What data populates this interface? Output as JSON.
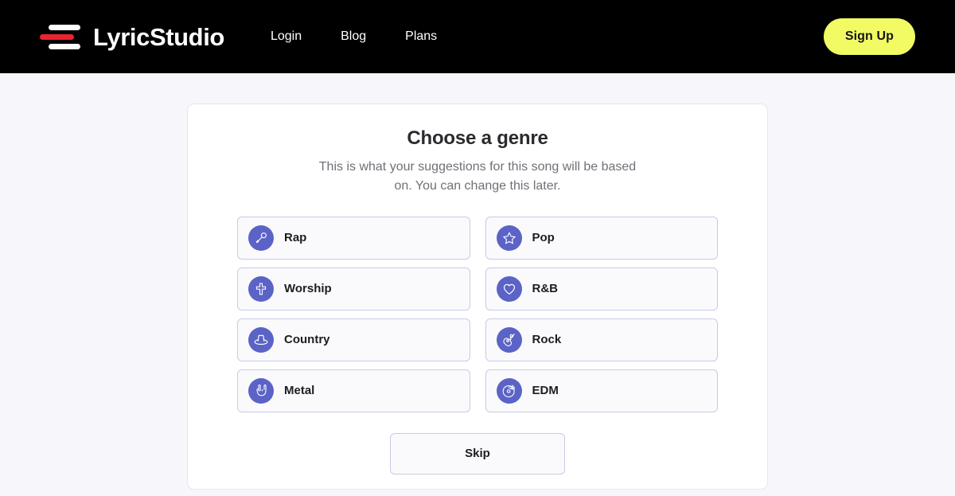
{
  "header": {
    "brand_name": "LyricStudio",
    "logo_icon": "lyricstudio-bars-logo",
    "logo_colors": {
      "bar_top": "#ffffff",
      "bar_middle": "#e8242f",
      "bar_bottom": "#ffffff"
    },
    "background_color": "#000000",
    "nav": [
      {
        "label": "Login",
        "name": "nav-link-login"
      },
      {
        "label": "Blog",
        "name": "nav-link-blog"
      },
      {
        "label": "Plans",
        "name": "nav-link-plans"
      }
    ],
    "signup_label": "Sign Up",
    "signup_color": "#f2fb63"
  },
  "card": {
    "title": "Choose a genre",
    "subtitle": "This is what your suggestions for this song will be based on. You can change this later.",
    "accent_color": "#5b63c7",
    "border_color": "#c7cbe8",
    "genres": [
      {
        "label": "Rap",
        "icon": "microphone-icon",
        "column": "left"
      },
      {
        "label": "Pop",
        "icon": "star-icon",
        "column": "right"
      },
      {
        "label": "Worship",
        "icon": "cross-icon",
        "column": "left"
      },
      {
        "label": "R&B",
        "icon": "heart-icon",
        "column": "right"
      },
      {
        "label": "Country",
        "icon": "cowboy-hat-icon",
        "column": "left"
      },
      {
        "label": "Rock",
        "icon": "guitar-icon",
        "column": "right"
      },
      {
        "label": "Metal",
        "icon": "rock-hand-icon",
        "column": "left"
      },
      {
        "label": "EDM",
        "icon": "turntable-icon",
        "column": "right"
      }
    ],
    "skip_label": "Skip"
  },
  "page": {
    "background_color": "#f7f7fb"
  }
}
